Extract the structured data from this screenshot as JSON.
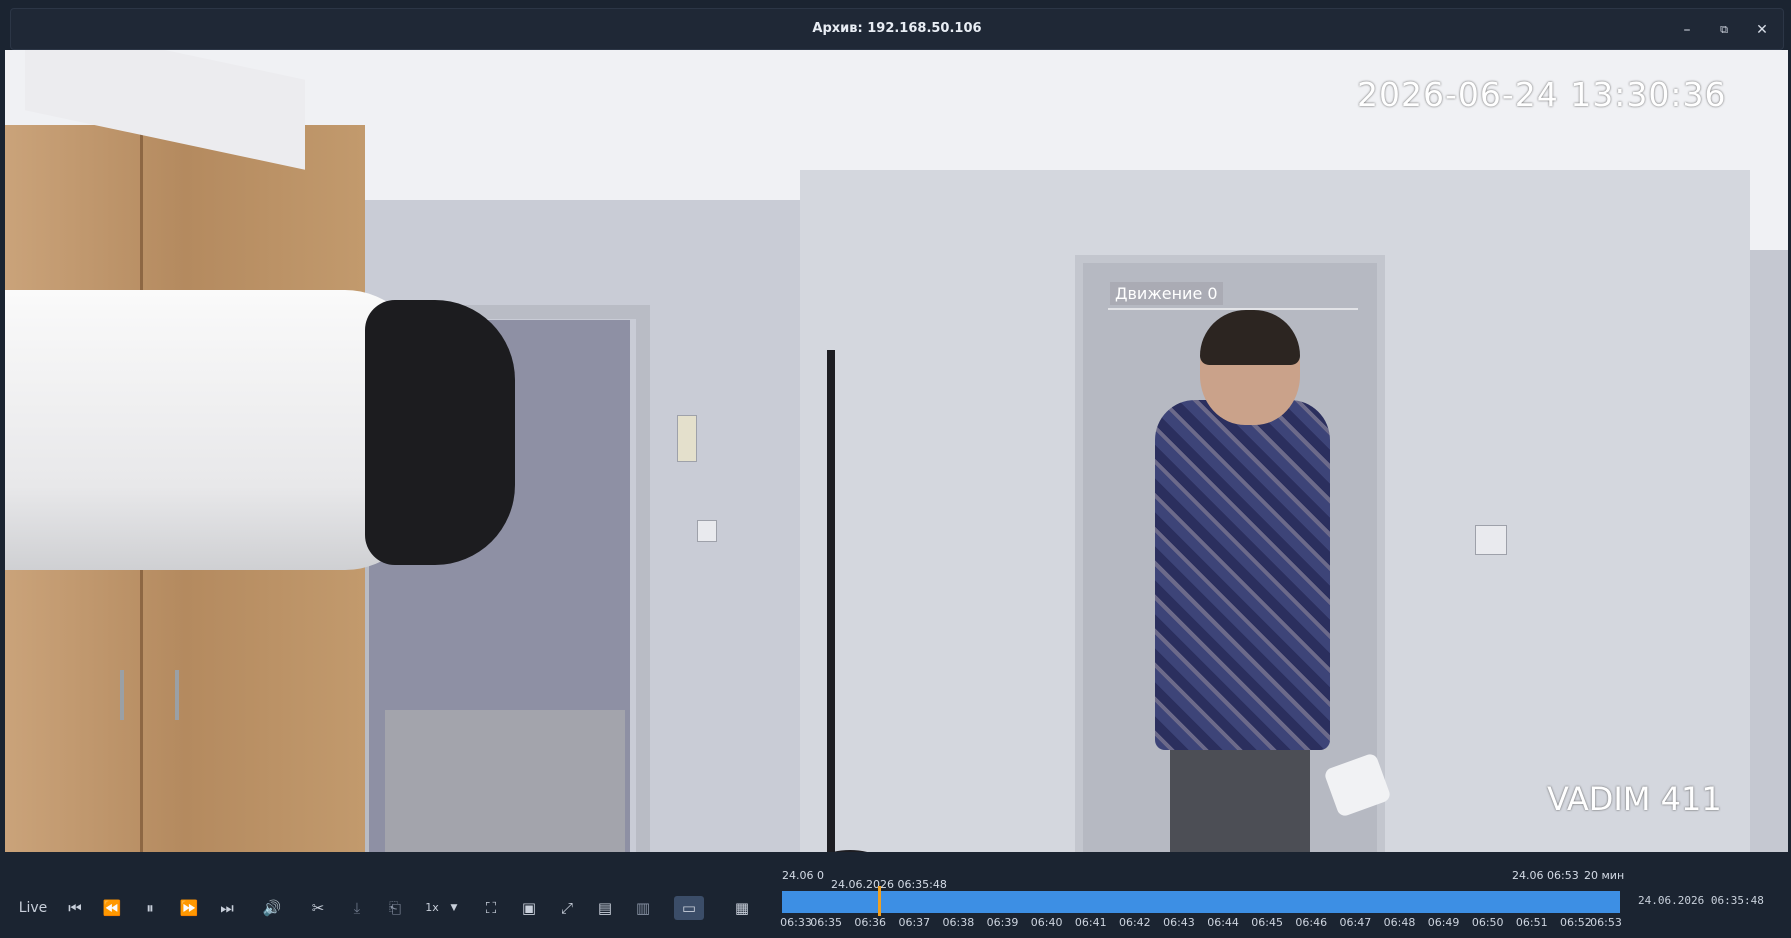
{
  "window": {
    "title": "Архив: 192.168.50.106",
    "minimize_icon": "minimize-icon",
    "restore_icon": "restore-icon",
    "close_icon": "close-icon"
  },
  "video": {
    "osd_datetime": "2026-06-24  13:30:36",
    "osd_camera_name": "VADIM 411",
    "motion_label": "Движение 0"
  },
  "controls": {
    "live_label": "Live",
    "speed_label": "1x",
    "icons": [
      "skip-back-icon",
      "rewind-icon",
      "pause-icon",
      "fast-forward-icon",
      "skip-forward-icon",
      "volume-icon",
      "cut-icon",
      "download-icon",
      "export-icon",
      "speed-dropdown-icon",
      "fit-icon",
      "snapshot-icon",
      "fullscreen-icon",
      "bookmark-icon",
      "panel-icon",
      "subtitles-icon",
      "calendar-icon"
    ]
  },
  "timeline": {
    "start_label": "24.06 0",
    "cursor_label": "24.06.2026 06:35:48",
    "end_label": "24.06 06:53",
    "span_label": "20 мин",
    "current_datetime": "24.06.2026 06:35:48",
    "ticks": [
      "06:33",
      "06:35",
      "06:36",
      "06:37",
      "06:38",
      "06:39",
      "06:40",
      "06:41",
      "06:42",
      "06:43",
      "06:44",
      "06:45",
      "06:46",
      "06:47",
      "06:48",
      "06:49",
      "06:50",
      "06:51",
      "06:52",
      "06:53"
    ],
    "bar_color": "#3d8fe4",
    "cursor_color": "#f0a020"
  }
}
